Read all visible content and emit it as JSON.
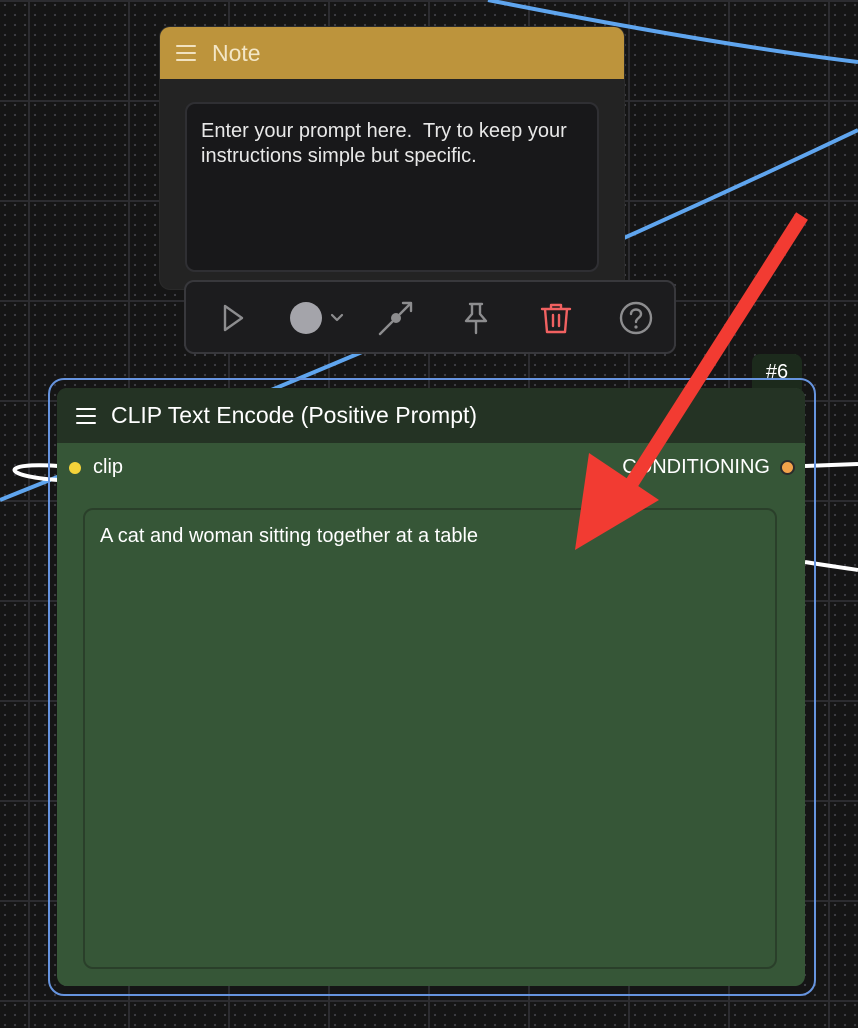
{
  "note_node": {
    "title": "Note",
    "text": "Enter your prompt here.  Try to keep your instructions simple but specific."
  },
  "toolbar": {
    "buttons": [
      {
        "name": "run-icon"
      },
      {
        "name": "color-circle-icon"
      },
      {
        "name": "bypass-icon"
      },
      {
        "name": "pin-icon"
      },
      {
        "name": "trash-icon"
      },
      {
        "name": "help-icon"
      }
    ],
    "colors": {
      "icon": "#8d8d8f",
      "color_swatch": "#a4a4aa",
      "delete": "#f16161"
    }
  },
  "clip_node": {
    "badge": "#6",
    "title": "CLIP Text Encode (Positive Prompt)",
    "input_label": "clip",
    "output_label": "CONDITIONING",
    "prompt_text": "A cat and woman sitting together at a table"
  },
  "colors": {
    "note_header": "#bd943c",
    "clip_header": "#243324",
    "clip_body": "#365637",
    "selection_outline": "#6694df",
    "link_blue": "#5fa5ee",
    "link_white": "#ffffff",
    "clip_dot": "#f4d33a",
    "conditioning_dot": "#f3a24a",
    "annotation_arrow": "#f23b32"
  }
}
